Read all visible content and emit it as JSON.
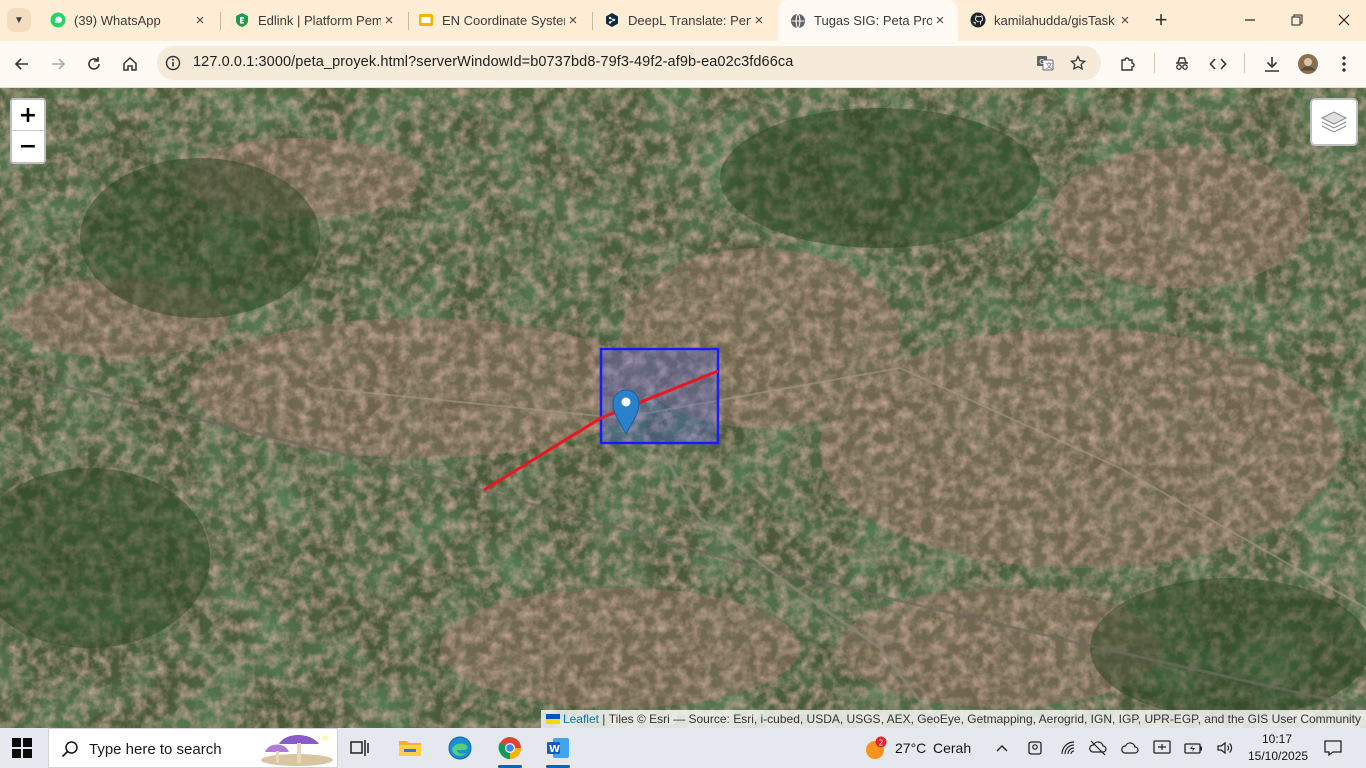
{
  "browser": {
    "tabs": [
      {
        "title": "(39) WhatsApp",
        "icon": "whatsapp-icon",
        "active": false
      },
      {
        "title": "Edlink | Platform Pem",
        "icon": "edlink-icon",
        "active": false
      },
      {
        "title": "EN Coordinate Systen",
        "icon": "slides-icon",
        "active": false
      },
      {
        "title": "DeepL Translate: Pen",
        "icon": "deepl-icon",
        "active": false
      },
      {
        "title": "Tugas SIG: Peta Proye",
        "icon": "globe-icon",
        "active": true
      },
      {
        "title": "kamilahudda/gisTask",
        "icon": "github-icon",
        "active": false
      }
    ],
    "url": "127.0.0.1:3000/peta_proyek.html?serverWindowId=b0737bd8-79f3-49f2-af9b-ea02c3fd66ca",
    "accent_color": "#ffedd6"
  },
  "map": {
    "zoom_in_label": "+",
    "zoom_out_label": "−",
    "layers_icon": "layers-icon",
    "attribution": {
      "leaflet": "Leaflet",
      "separator": " | ",
      "text": "Tiles © Esri — Source: Esri, i-cubed, USDA, USGS, AEX, GeoEye, Getmapping, Aerogrid, IGN, IGP, UPR-EGP, and the GIS User Community"
    },
    "overlays": {
      "polygon_color": "#1a1aff",
      "line_color": "#e8181e",
      "marker_color": "#2a81cb"
    }
  },
  "taskbar": {
    "search_placeholder": "Type here to search",
    "weather": {
      "badge": "2",
      "temp": "27°C",
      "condition": "Cerah"
    },
    "clock": {
      "time": "10:17",
      "date": "15/10/2025"
    }
  }
}
